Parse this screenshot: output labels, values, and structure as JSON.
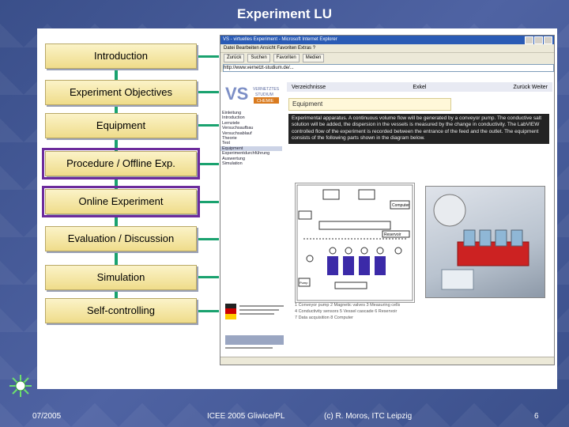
{
  "slide": {
    "title": "Experiment LU",
    "flow_steps": [
      {
        "label": "Introduction",
        "highlighted": false
      },
      {
        "label": "Experiment Objectives",
        "highlighted": false
      },
      {
        "label": "Equipment",
        "highlighted": false
      },
      {
        "label": "Procedure / Offline Exp.",
        "highlighted": true
      },
      {
        "label": "Online Experiment",
        "highlighted": true
      },
      {
        "label": "Evaluation / Discussion",
        "highlighted": false
      },
      {
        "label": "Simulation",
        "highlighted": false
      },
      {
        "label": "Self-controlling",
        "highlighted": false
      }
    ],
    "footer": {
      "date": "07/2005",
      "conference": "ICEE 2005 Gliwice/PL",
      "author": "(c) R. Moros, ITC Leipzig",
      "page": "6"
    }
  },
  "browser": {
    "window_title": "VS - virtuelles Experiment - Microsoft Internet Explorer",
    "menu": "Datei   Bearbeiten   Ansicht   Favoriten   Extras   ?",
    "toolbar": [
      "Zurück",
      "Suchen",
      "Favoriten",
      "Medien"
    ],
    "address": "http://www.vernetzt-studium.de/...",
    "header_links": [
      "Verzeichnisse",
      "Exkel",
      "Zurück  Weiter"
    ],
    "section_title": "Equipment",
    "left_nav": [
      "Einleitung",
      "Introduction",
      "Lernziele",
      "Versuchsaufbau",
      "Versuchsablauf",
      "Theorie",
      "Test",
      "Equipment",
      "Experimentdurchführung",
      "Auswertung",
      "Simulation"
    ],
    "left_nav_selected": 7,
    "description": "Experimental apparatus. A continuous volume flow will be generated by a conveyor pump. The conductive salt solution will be added, the dispersion in the vessels is measured by the change in conductivity. The LabVIEW controlled flow of the experiment is recorded between the entrance of the feed and the outlet. The equipment consists of the following parts shown in the diagram below.",
    "legend": [
      "1 Conveyor pump  2 Magnetic valves  3 Measuring cells",
      "4 Conductivity sensors  5 Vessel cascade  6 Reservoir",
      "7 Data acquisition  8 Computer"
    ],
    "diagram_labels": [
      "Computer",
      "Reservoir",
      "Pump"
    ]
  }
}
